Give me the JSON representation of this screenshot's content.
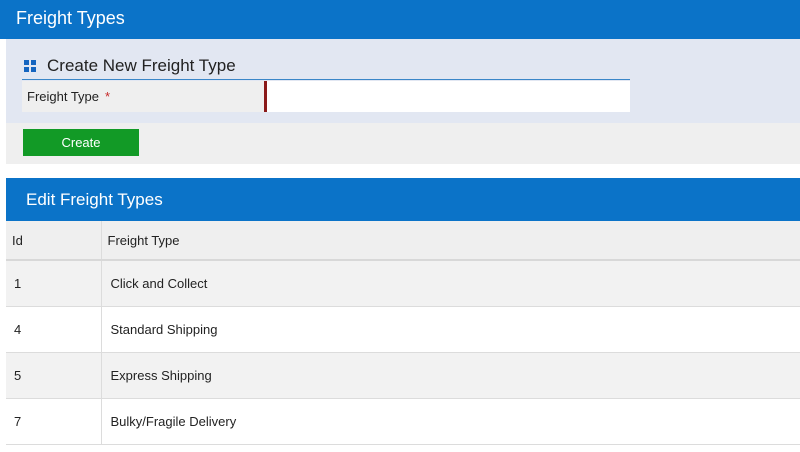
{
  "page": {
    "title": "Freight Types"
  },
  "create_panel": {
    "title": "Create New Freight Type",
    "icon": "grid-icon",
    "field_label": "Freight Type",
    "required_marker": "*",
    "field_value": "",
    "button_label": "Create"
  },
  "edit_panel": {
    "title": "Edit Freight Types",
    "columns": [
      "Id",
      "Freight Type"
    ],
    "rows": [
      {
        "id": "1",
        "type": "Click and Collect"
      },
      {
        "id": "4",
        "type": "Standard Shipping"
      },
      {
        "id": "5",
        "type": "Express Shipping"
      },
      {
        "id": "7",
        "type": "Bulky/Fragile Delivery"
      }
    ]
  },
  "colors": {
    "header_blue": "#0b73c8",
    "panel_bg": "#e2e7f2",
    "create_green": "#129a26",
    "required_red": "#c62828"
  }
}
